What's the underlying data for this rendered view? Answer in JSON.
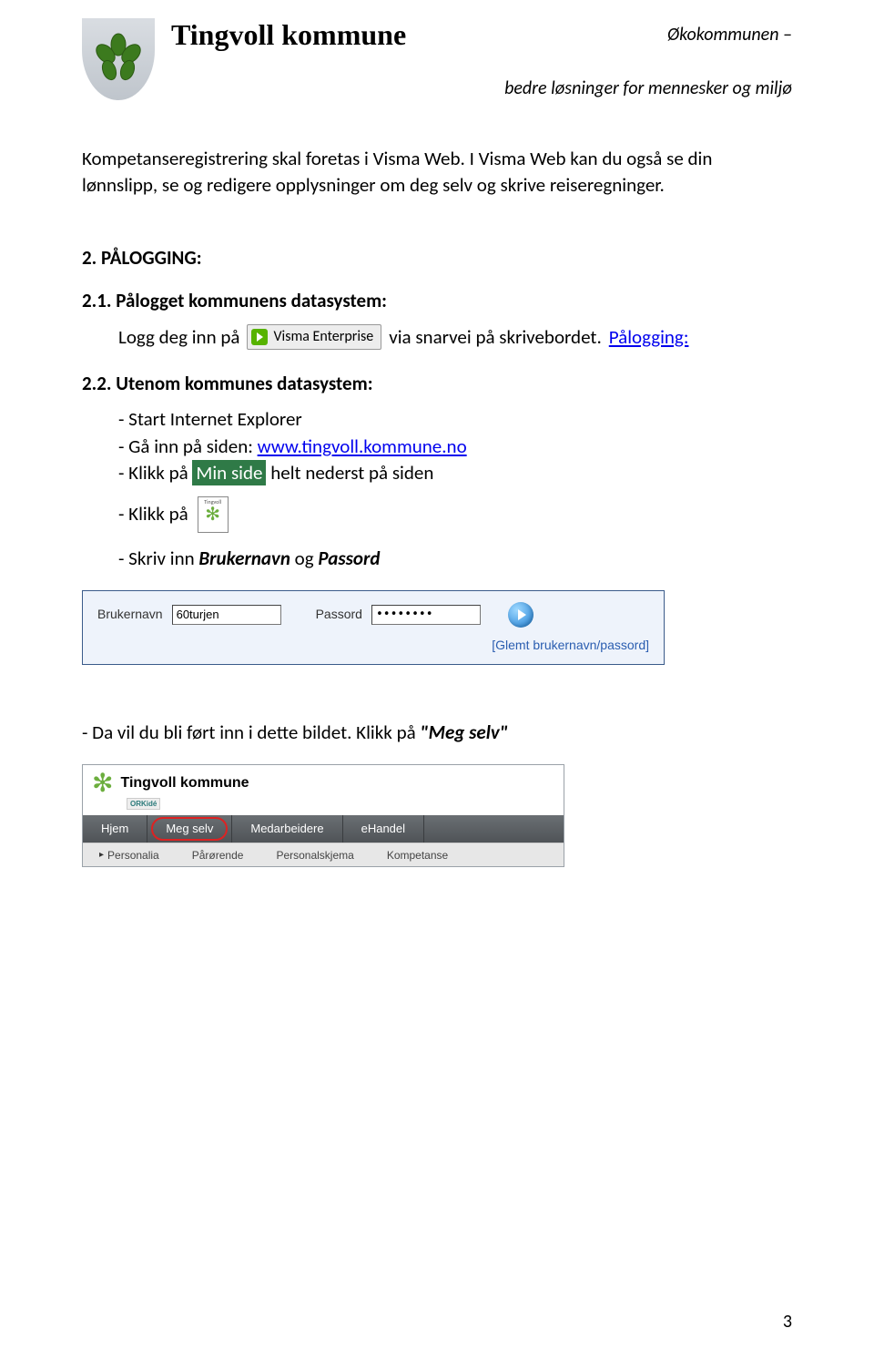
{
  "header": {
    "title": "Tingvoll kommune",
    "right1": "Økokommunen –",
    "right2": "bedre løsninger for mennesker og miljø"
  },
  "intro": {
    "p1": "Kompetanseregistrering skal foretas i Visma Web. I Visma Web kan du også se din lønnslipp, se og redigere opplysninger om deg selv og skrive reiseregninger."
  },
  "s2": {
    "heading": "2.   PÅLOGGING:",
    "s21_head": "2.1. Pålogget kommunens datasystem:",
    "s21_login_on": "Logg deg inn på",
    "visma_label": "Visma Enterprise",
    "s21_via": " via snarvei på skrivebordet. ",
    "s21_link": "Pålogging:",
    "s22_head": "2.2. Utenom kommunes datasystem:",
    "bullets": {
      "b1": "- Start Internet Explorer",
      "b2a": "- Gå inn på siden: ",
      "b2b": "www.tingvoll.kommune.no",
      "b3a": "- Klikk på ",
      "b3b": "Min side",
      "b3c": " helt nederst på siden",
      "b4": "- Klikk på",
      "b5a": "- Skriv inn ",
      "b5b": "Brukernavn",
      "b5c": " og ",
      "b5d": "Passord"
    }
  },
  "login_form": {
    "user_label": "Brukernavn",
    "user_value": "60turjen",
    "pass_label": "Passord",
    "pass_value": "••••••••",
    "forgot": "[Glemt brukernavn/passord]"
  },
  "after_login": {
    "p1a": "- Da vil du bli ført inn i dette bildet. Klikk på ",
    "p1b": "\"Meg selv\""
  },
  "nav": {
    "brand": "Tingvoll kommune",
    "sublogo": "ORKidé",
    "tabs": [
      "Hjem",
      "Meg selv",
      "Medarbeidere",
      "eHandel"
    ],
    "sub": [
      "Personalia",
      "Pårørende",
      "Personalskjema",
      "Kompetanse"
    ]
  },
  "page_number": "3"
}
